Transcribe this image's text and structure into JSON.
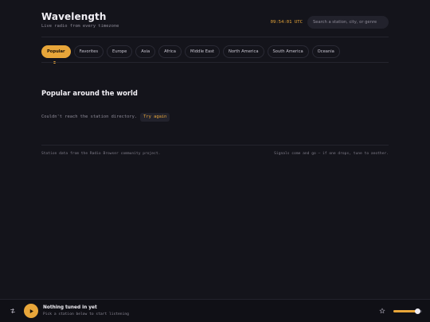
{
  "header": {
    "title": "Wavelength",
    "subtitle": "Live radio from every timezone",
    "clock": "09:54:01 UTC",
    "search_placeholder": "Search a station, city, or genre"
  },
  "tabs": [
    {
      "label": "Popular",
      "active": true
    },
    {
      "label": "Favorites",
      "active": false
    },
    {
      "label": "Europe",
      "active": false
    },
    {
      "label": "Asia",
      "active": false
    },
    {
      "label": "Africa",
      "active": false
    },
    {
      "label": "Middle East",
      "active": false
    },
    {
      "label": "North America",
      "active": false
    },
    {
      "label": "South America",
      "active": false
    },
    {
      "label": "Oceania",
      "active": false
    }
  ],
  "section": {
    "title": "Popular around the world",
    "error_text": "Couldn't reach the station directory.",
    "retry_label": "Try again"
  },
  "footer": {
    "left": "Station data from the Radio Browser community project.",
    "right": "Signals come and go — if one drops, tune to another."
  },
  "player": {
    "title": "Nothing tuned in yet",
    "subtitle": "Pick a station below to start listening",
    "volume": 0.85
  },
  "colors": {
    "accent": "#e8a63a",
    "background": "#14141b"
  },
  "icons": {
    "shuffle": "shuffle-icon",
    "play": "play-icon",
    "favorite": "star-icon"
  }
}
